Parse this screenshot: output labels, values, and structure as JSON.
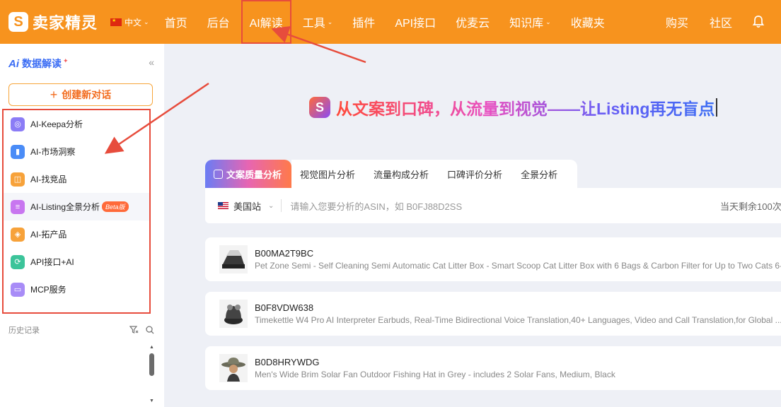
{
  "brand": {
    "logo_glyph": "S",
    "name": "卖家精灵"
  },
  "language": {
    "label": "中文"
  },
  "nav": {
    "items": [
      {
        "label": "首页",
        "dropdown": false
      },
      {
        "label": "后台",
        "dropdown": false
      },
      {
        "label": "AI解读",
        "dropdown": false
      },
      {
        "label": "工具",
        "dropdown": true
      },
      {
        "label": "插件",
        "dropdown": false
      },
      {
        "label": "API接口",
        "dropdown": false
      },
      {
        "label": "优麦云",
        "dropdown": false
      },
      {
        "label": "知识库",
        "dropdown": true
      },
      {
        "label": "收藏夹",
        "dropdown": false
      }
    ],
    "right": [
      {
        "label": "购买"
      },
      {
        "label": "社区"
      }
    ],
    "bell_icon": "bell-icon"
  },
  "sidebar": {
    "title_mark": "Ai",
    "title": "数据解读",
    "collapse_glyph": "«",
    "new_chat_label": "创建新对话",
    "menu": [
      {
        "label": "AI-Keepa分析",
        "icon": "keepa-icon",
        "color": "#8b7cf6",
        "glyph": "◎"
      },
      {
        "label": "AI-市场洞察",
        "icon": "bar-chart-icon",
        "color": "#4a8cf7",
        "glyph": "▮"
      },
      {
        "label": "AI-找竞品",
        "icon": "search-product-icon",
        "color": "#f7a23a",
        "glyph": "◫"
      },
      {
        "label": "AI-Listing全景分析",
        "icon": "listing-icon",
        "color": "#c876f0",
        "glyph": "≡",
        "badge": "Beta版"
      },
      {
        "label": "AI-拓产品",
        "icon": "cube-icon",
        "color": "#f7a23a",
        "glyph": "◈"
      },
      {
        "label": "API接口+AI",
        "icon": "api-icon",
        "color": "#3cc49a",
        "glyph": "⟳"
      },
      {
        "label": "MCP服务",
        "icon": "mcp-icon",
        "color": "#a88cf7",
        "glyph": "▭"
      }
    ],
    "history_label": "历史记录"
  },
  "headline": {
    "logo_glyph": "S",
    "text": "从文案到口碑，从流量到视觉——让Listing再无盲点"
  },
  "tabs": [
    {
      "label": "文案质量分析",
      "active": true
    },
    {
      "label": "视觉图片分析",
      "active": false
    },
    {
      "label": "流量构成分析",
      "active": false
    },
    {
      "label": "口碑评价分析",
      "active": false
    },
    {
      "label": "全景分析",
      "active": false
    }
  ],
  "search": {
    "site": "美国站",
    "placeholder": "请输入您要分析的ASIN，如 B0FJ88D2SS",
    "quota": "当天剩余100次"
  },
  "products": [
    {
      "asin": "B00MA2T9BC",
      "title": "Pet Zone Semi - Self Cleaning Semi Automatic Cat Litter Box - Smart Scoop Cat Litter Box with 6 Bags & Carbon Filter for Up to Two Cats 6-..."
    },
    {
      "asin": "B0F8VDW638",
      "title": "Timekettle W4 Pro AI Interpreter Earbuds, Real-Time Bidirectional Voice Translation,40+ Languages, Video and Call Translation,for Global ..."
    },
    {
      "asin": "B0D8HRYWDG",
      "title": "Men's Wide Brim Solar Fan Outdoor Fishing Hat in Grey - includes 2 Solar Fans, Medium, Black"
    }
  ],
  "colors": {
    "brand_orange": "#f7931e",
    "annotation_red": "#e74c3c",
    "accent_blue": "#3a6cf4"
  }
}
